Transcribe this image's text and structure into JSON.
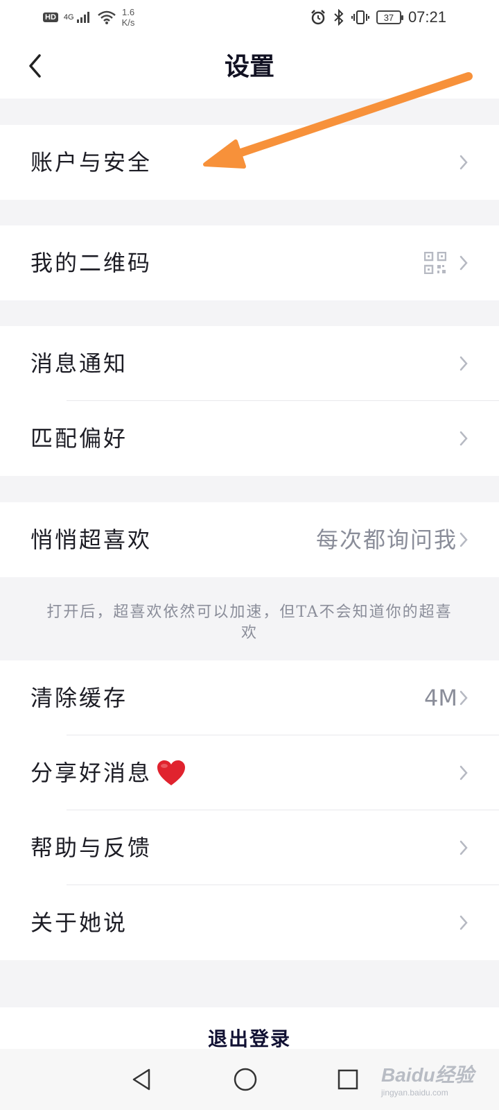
{
  "status_bar": {
    "hd": "HD",
    "network": "4G",
    "speed_value": "1.6",
    "speed_unit": "K/s",
    "battery": "37",
    "time": "07:21"
  },
  "header": {
    "title": "设置",
    "back_icon": "chevron-left-icon"
  },
  "sections": {
    "account": {
      "label": "账户与安全"
    },
    "qrcode": {
      "label": "我的二维码",
      "icon": "qr-code-icon"
    },
    "notify": {
      "label": "消息通知"
    },
    "match": {
      "label": "匹配偏好"
    },
    "superlike": {
      "label": "悄悄超喜欢",
      "value": "每次都询问我"
    },
    "superlike_note": "打开后，超喜欢依然可以加速，但TA不会知道你的超喜欢",
    "cache": {
      "label": "清除缓存",
      "value": "4M"
    },
    "share": {
      "label": "分享好消息",
      "icon": "heart-icon"
    },
    "help": {
      "label": "帮助与反馈"
    },
    "about": {
      "label": "关于她说"
    }
  },
  "logout": {
    "label": "退出登录"
  },
  "system_nav": {
    "back": "triangle-back-icon",
    "home": "circle-home-icon",
    "recents": "square-recents-icon"
  },
  "watermark": {
    "main": "Baidu经验",
    "sub": "jingyan.baidu.com"
  },
  "colors": {
    "page_bg": "#f4f4f6",
    "text": "#1c1c24",
    "secondary_text": "#8a8d99",
    "arrow_annotation": "#f7913a",
    "heart": "#e0232e"
  }
}
